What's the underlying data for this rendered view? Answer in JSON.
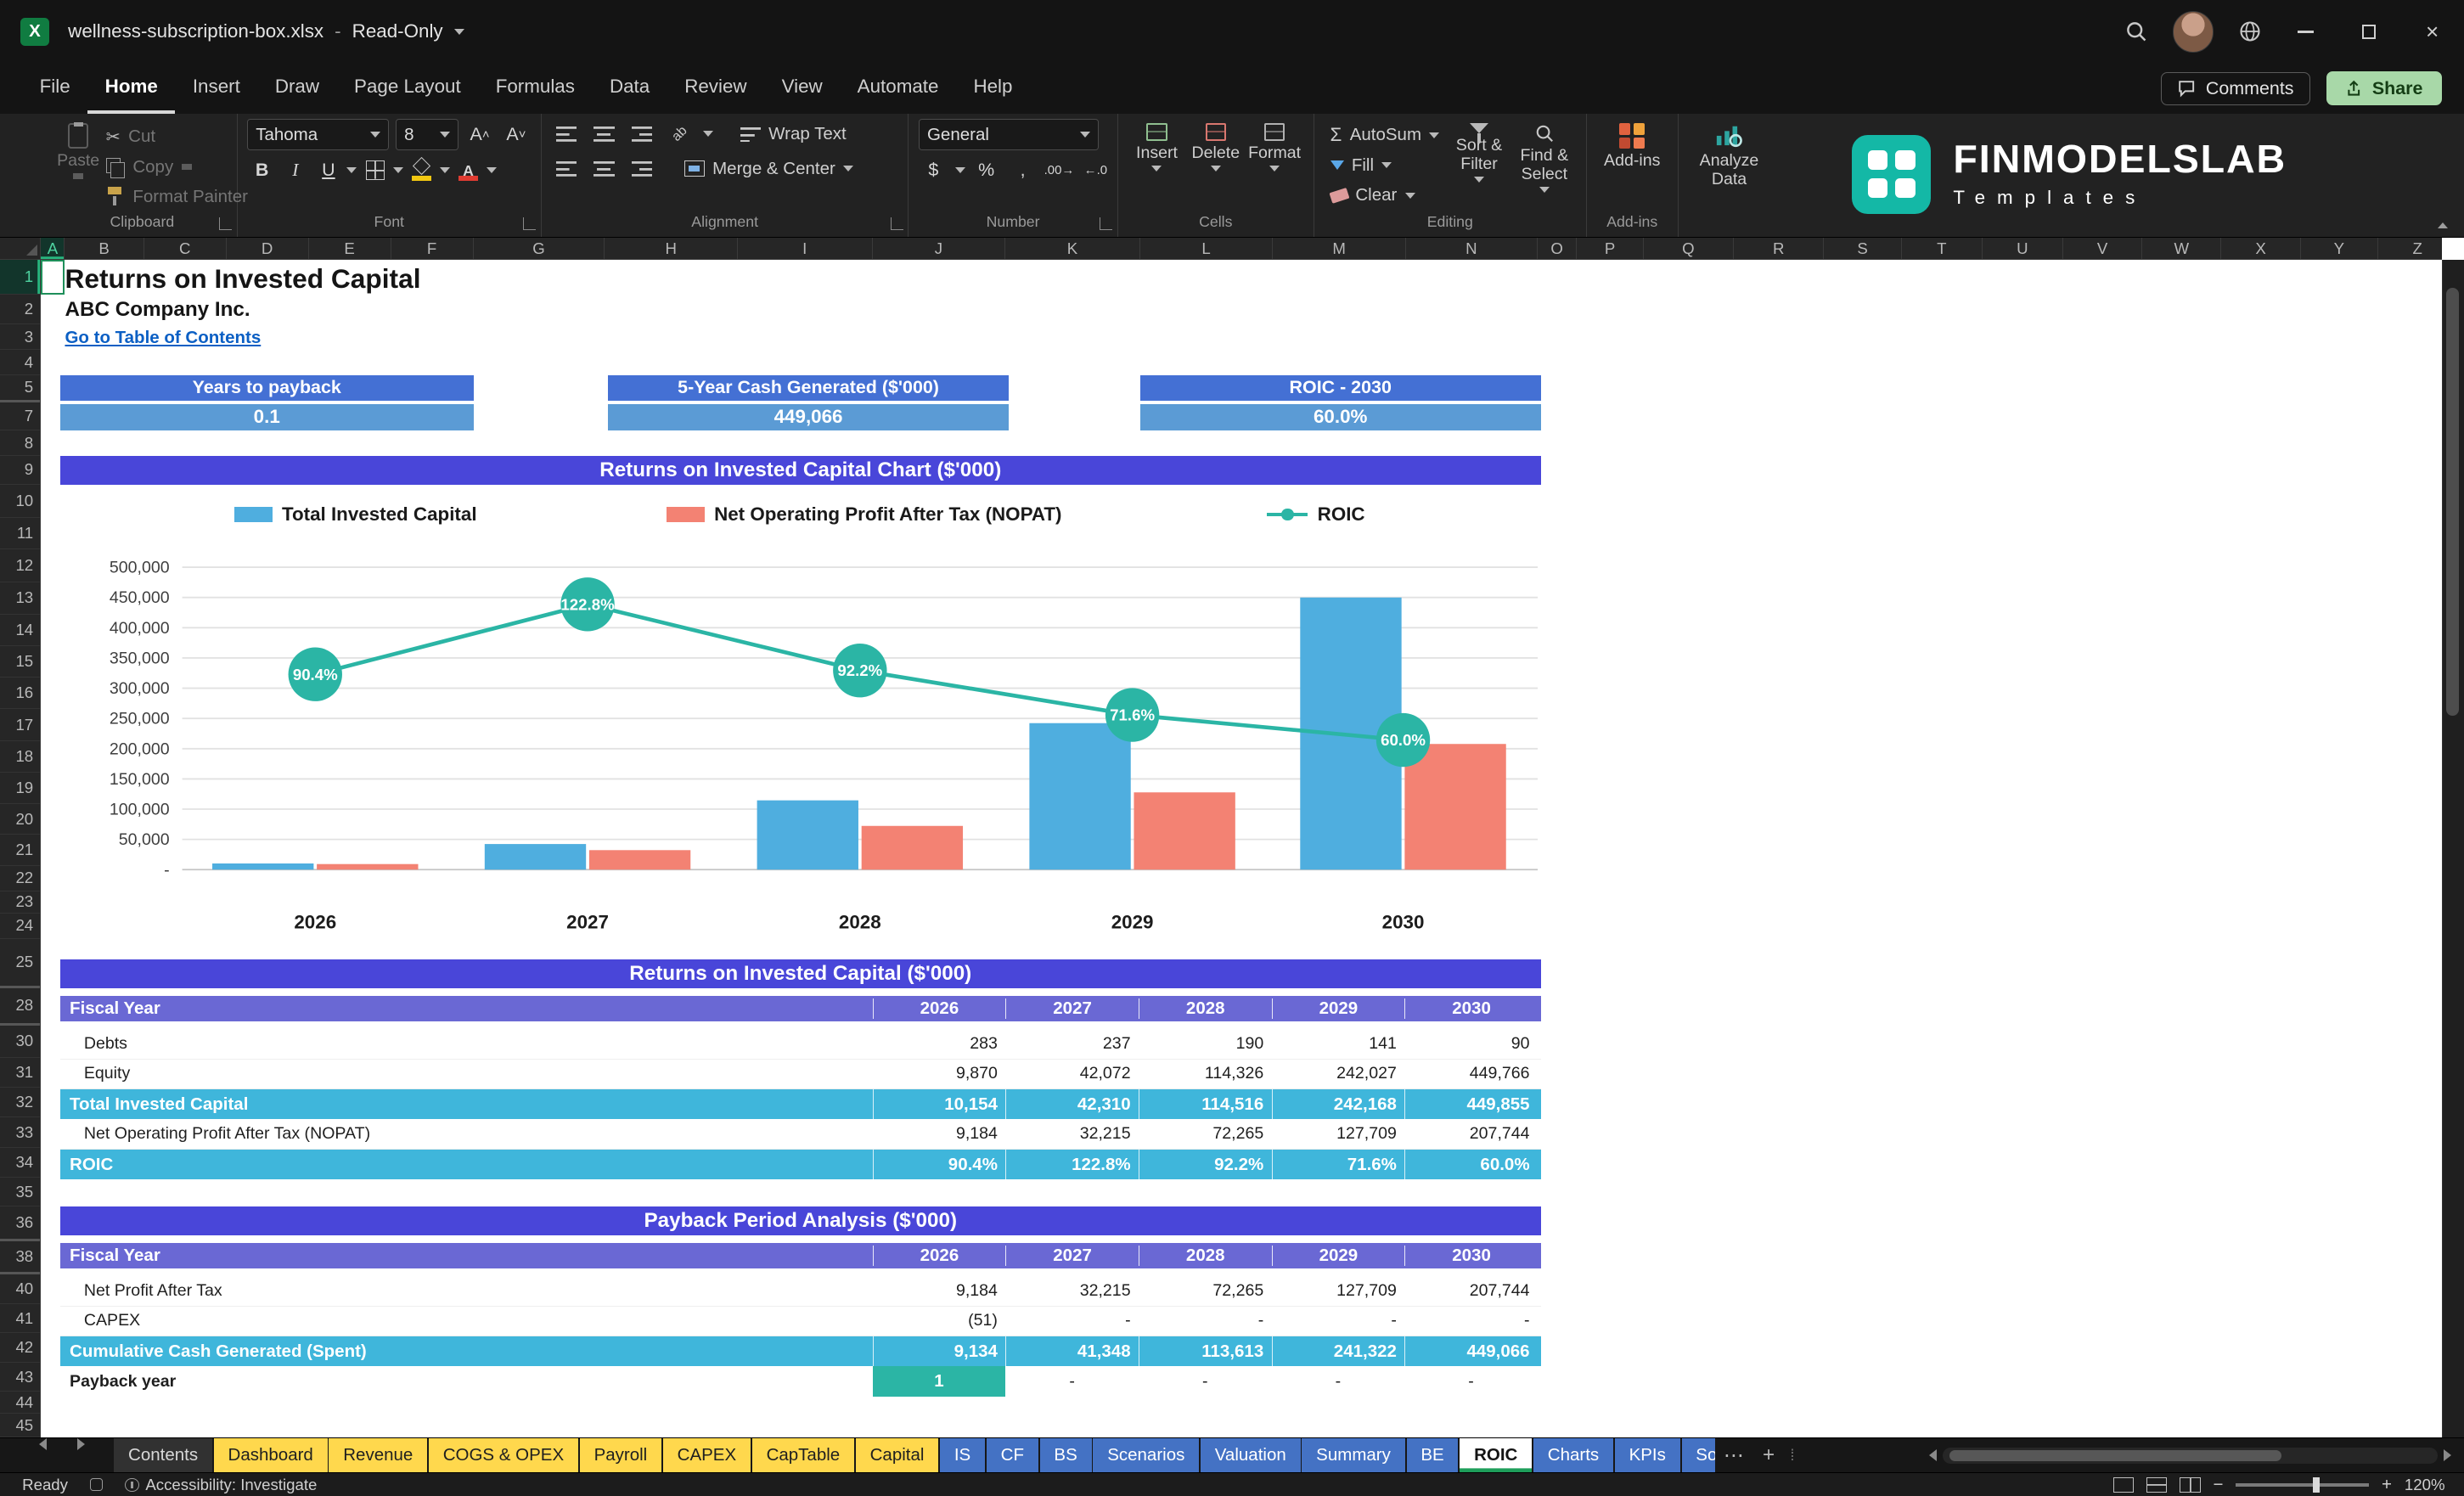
{
  "titlebar": {
    "filename": "wellness-subscription-box.xlsx",
    "mode": "Read-Only"
  },
  "menubar": {
    "items": [
      "File",
      "Home",
      "Insert",
      "Draw",
      "Page Layout",
      "Formulas",
      "Data",
      "Review",
      "View",
      "Automate",
      "Help"
    ],
    "active": "Home",
    "comments": "Comments",
    "share": "Share"
  },
  "ribbon": {
    "groups": {
      "clipboard": "Clipboard",
      "font": "Font",
      "alignment": "Alignment",
      "number": "Number",
      "cells": "Cells",
      "editing": "Editing",
      "addins": "Add-ins"
    },
    "clipboard": {
      "paste": "Paste",
      "cut": "Cut",
      "copy": "Copy",
      "format_painter": "Format Painter"
    },
    "font": {
      "name": "Tahoma",
      "size": "8"
    },
    "alignment": {
      "wrap": "Wrap Text",
      "merge": "Merge & Center"
    },
    "number": {
      "format": "General",
      "currency": "$",
      "percent": "%",
      "comma": ",",
      "dec_inc": ".00",
      "dec_dec": ".0"
    },
    "cells": {
      "insert": "Insert",
      "delete": "Delete",
      "format": "Format"
    },
    "editing": {
      "autosum": "AutoSum",
      "fill": "Fill",
      "clear": "Clear",
      "sort": "Sort & Filter",
      "find": "Find & Select"
    },
    "addins": {
      "button": "Add-ins",
      "analyze": "Analyze Data"
    },
    "brand": {
      "name": "FINMODELSLAB",
      "sub": "Templates"
    }
  },
  "sheet": {
    "columns": [
      "A",
      "B",
      "C",
      "D",
      "E",
      "F",
      "G",
      "H",
      "I",
      "J",
      "K",
      "L",
      "M",
      "N",
      "O",
      "P",
      "Q",
      "R",
      "S",
      "T",
      "U",
      "V",
      "W",
      "X",
      "Y",
      "Z"
    ],
    "row_numbers": [
      1,
      2,
      3,
      4,
      5,
      7,
      8,
      9,
      10,
      11,
      12,
      13,
      14,
      15,
      16,
      17,
      18,
      19,
      20,
      21,
      22,
      23,
      24,
      25,
      28,
      30,
      31,
      32,
      33,
      34,
      35,
      36,
      38,
      40,
      41,
      42,
      43,
      44,
      45
    ],
    "title": "Returns on Invested Capital",
    "company": "ABC Company Inc.",
    "link": "Go to Table of Contents",
    "kpis": [
      {
        "label": "Years to payback",
        "value": "0.1"
      },
      {
        "label": "5-Year Cash Generated ($'000)",
        "value": "449,066"
      },
      {
        "label": "ROIC - 2030",
        "value": "60.0%"
      }
    ]
  },
  "chart_data": {
    "type": "bar",
    "title": "Returns on Invested Capital Chart ($'000)",
    "categories": [
      "2026",
      "2027",
      "2028",
      "2029",
      "2030"
    ],
    "series": [
      {
        "name": "Total Invested Capital",
        "kind": "bar",
        "color": "#4FAEDF",
        "values": [
          10154,
          42310,
          114516,
          242168,
          449855
        ]
      },
      {
        "name": "Net Operating Profit After Tax (NOPAT)",
        "kind": "bar",
        "color": "#F38273",
        "values": [
          9184,
          32215,
          72265,
          127709,
          207744
        ]
      },
      {
        "name": "ROIC",
        "kind": "line",
        "color": "#2BB5A5",
        "values_pct": [
          90.4,
          122.8,
          92.2,
          71.6,
          60.0
        ],
        "point_labels": [
          "90.4%",
          "122.8%",
          "92.2%",
          "71.6%",
          "60.0%"
        ]
      }
    ],
    "y_axis": {
      "min": 0,
      "max": 500000,
      "step": 50000,
      "tick_labels": [
        "-",
        "50,000",
        "100,000",
        "150,000",
        "200,000",
        "250,000",
        "300,000",
        "350,000",
        "400,000",
        "450,000",
        "500,000"
      ]
    },
    "secondary_axis_max_hint": 140,
    "grid": true,
    "legend_position": "top"
  },
  "table1": {
    "title": "Returns on Invested Capital ($'000)",
    "header": {
      "label": "Fiscal Year",
      "years": [
        "2026",
        "2027",
        "2028",
        "2029",
        "2030"
      ]
    },
    "rows": [
      {
        "label": "Debts",
        "style": "plain",
        "values": [
          "283",
          "237",
          "190",
          "141",
          "90"
        ]
      },
      {
        "label": "Equity",
        "style": "plain",
        "values": [
          "9,870",
          "42,072",
          "114,326",
          "242,027",
          "449,766"
        ]
      },
      {
        "label": "Total Invested Capital",
        "style": "total",
        "values": [
          "10,154",
          "42,310",
          "114,516",
          "242,168",
          "449,855"
        ]
      },
      {
        "label": "Net Operating Profit After Tax (NOPAT)",
        "style": "plain",
        "values": [
          "9,184",
          "32,215",
          "72,265",
          "127,709",
          "207,744"
        ]
      },
      {
        "label": "ROIC",
        "style": "total",
        "values": [
          "90.4%",
          "122.8%",
          "92.2%",
          "71.6%",
          "60.0%"
        ]
      }
    ]
  },
  "table2": {
    "title": "Payback Period Analysis ($'000)",
    "header": {
      "label": "Fiscal Year",
      "years": [
        "2026",
        "2027",
        "2028",
        "2029",
        "2030"
      ]
    },
    "rows": [
      {
        "label": "Net Profit After Tax",
        "style": "plain",
        "values": [
          "9,184",
          "32,215",
          "72,265",
          "127,709",
          "207,744"
        ]
      },
      {
        "label": "CAPEX",
        "style": "plain",
        "values": [
          "(51)",
          "-",
          "-",
          "-",
          "-"
        ]
      },
      {
        "label": "Cumulative Cash Generated (Spent)",
        "style": "total",
        "values": [
          "9,134",
          "41,348",
          "113,613",
          "241,322",
          "449,066"
        ]
      },
      {
        "label": "Payback year",
        "style": "payback",
        "highlight_col": 0,
        "values": [
          "1",
          "-",
          "-",
          "-",
          "-"
        ]
      }
    ]
  },
  "tabs": [
    {
      "label": "Contents",
      "type": "neutral"
    },
    {
      "label": "Dashboard",
      "type": "yellow"
    },
    {
      "label": "Revenue",
      "type": "yellow"
    },
    {
      "label": "COGS & OPEX",
      "type": "yellow"
    },
    {
      "label": "Payroll",
      "type": "yellow"
    },
    {
      "label": "CAPEX",
      "type": "yellow"
    },
    {
      "label": "CapTable",
      "type": "yellow"
    },
    {
      "label": "Capital",
      "type": "yellow"
    },
    {
      "label": "IS",
      "type": "blue"
    },
    {
      "label": "CF",
      "type": "blue"
    },
    {
      "label": "BS",
      "type": "blue"
    },
    {
      "label": "Scenarios",
      "type": "blue"
    },
    {
      "label": "Valuation",
      "type": "blue"
    },
    {
      "label": "Summary",
      "type": "blue"
    },
    {
      "label": "BE",
      "type": "blue"
    },
    {
      "label": "ROIC",
      "type": "active"
    },
    {
      "label": "Charts",
      "type": "blue"
    },
    {
      "label": "KPIs",
      "type": "blue"
    },
    {
      "label": "So",
      "type": "blue",
      "truncated": true
    }
  ],
  "statusbar": {
    "ready": "Ready",
    "accessibility": "Accessibility: Investigate",
    "zoom": "120%"
  },
  "colors": {
    "section_header": "#4946D9",
    "table_header": "#6A68D4",
    "kpi_header": "#4470D4",
    "kpi_value": "#5B9BD5",
    "total_row": "#3FB6DB",
    "payback_cell": "#2BB5A5",
    "link": "#0B5FC4",
    "bar_total_invested": "#4FAEDF",
    "bar_nopat": "#F38273",
    "roic_line": "#2BB5A5",
    "tab_yellow": "#FFD84D",
    "tab_blue": "#4472C4",
    "tab_neutral": "#313131",
    "tab_active_bg": "#FFFFFF",
    "tab_active_underline": "#1E9E5A",
    "brand_teal": "#14B8A6"
  }
}
